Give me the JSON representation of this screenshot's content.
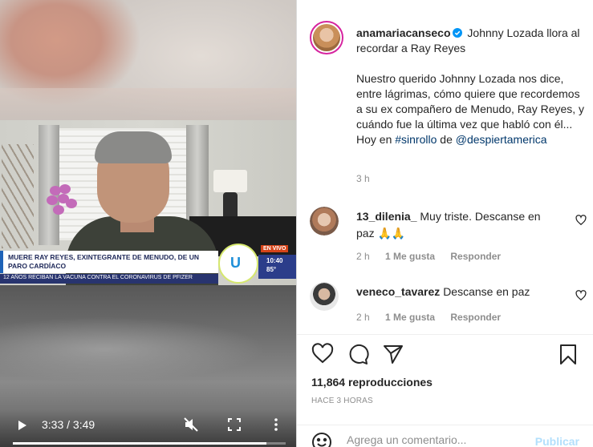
{
  "video": {
    "lower_third_title": "Muere Ray Reyes, exintegrante de Menudo, de un paro cardíaco",
    "ticker": "12 años reciban la vacuna contra el coronavirus de Pfizer",
    "live_badge": "EN VIVO",
    "channel_logo": "U",
    "clock": "10:40",
    "temperature": "85°",
    "time_display": "3:33 / 3:49",
    "progress": 0.93
  },
  "caption": {
    "username": "anamariacanseco",
    "headline": "Johnny Lozada llora al recordar a Ray Reyes",
    "body": "Nuestro querido Johnny Lozada nos dice, entre lágrimas, cómo quiere que recordemos a su ex compañero de Menudo, Ray Reyes, y cuándo fue la última vez que habló con él... Hoy en ",
    "hashtag": "#sinrollo",
    "connector": " de ",
    "mention": "@despiertamerica",
    "time": "3 h"
  },
  "comments": [
    {
      "username": "13_dilenia_",
      "text": "Muy triste. Descanse en paz",
      "emoji": "🙏🙏",
      "time": "2 h",
      "likes": "1 Me gusta",
      "reply": "Responder"
    },
    {
      "username": "veneco_tavarez",
      "text": "Descanse en paz",
      "time": "2 h",
      "likes": "1 Me gusta",
      "reply": "Responder"
    }
  ],
  "stats": {
    "views": "11,864 reproducciones",
    "ago": "HACE 3 HORAS"
  },
  "add_comment": {
    "placeholder": "Agrega un comentario...",
    "publish": "Publicar"
  },
  "colors": {
    "link": "#00376b",
    "muted": "#8e8e8e",
    "publish_disabled": "#b2dffc",
    "verified": "#0095f6"
  }
}
